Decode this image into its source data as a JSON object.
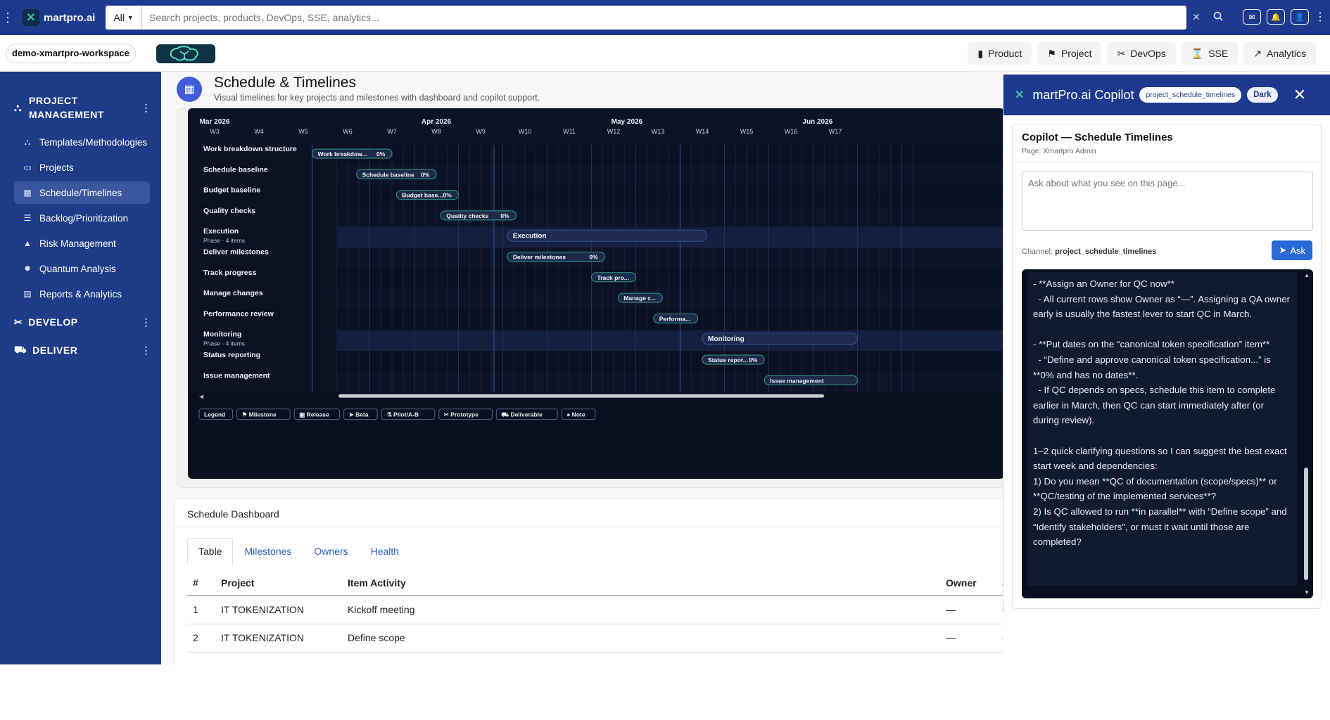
{
  "topbar": {
    "brand": "martpro.ai",
    "search_scope": "All",
    "search_placeholder": "Search projects, products, DevOps, SSE, analytics..."
  },
  "workspace": {
    "name": "demo-xmartpro-workspace",
    "nav": [
      "Product",
      "Project",
      "DevOps",
      "SSE",
      "Analytics"
    ]
  },
  "sidebar": {
    "section_pm": "PROJECT MANAGEMENT",
    "items": [
      {
        "label": "Templates/Methodologies",
        "icon": "diagram-icon"
      },
      {
        "label": "Projects",
        "icon": "folder-icon"
      },
      {
        "label": "Schedule/Timelines",
        "icon": "calendar-icon"
      },
      {
        "label": "Backlog/Prioritization",
        "icon": "list-icon"
      },
      {
        "label": "Risk Management",
        "icon": "warning-icon"
      },
      {
        "label": "Quantum Analysis",
        "icon": "gear-icon"
      },
      {
        "label": "Reports & Analytics",
        "icon": "report-icon"
      }
    ],
    "section_develop": "DEVELOP",
    "section_deliver": "DELIVER"
  },
  "page": {
    "title": "Schedule & Timelines",
    "subtitle": "Visual timelines for key projects and milestones with dashboard and copilot support."
  },
  "gantt": {
    "months": [
      {
        "label": "Mar 2026",
        "week": 3
      },
      {
        "label": "Apr 2026",
        "week": 8
      },
      {
        "label": "May 2026",
        "week": 12.3
      },
      {
        "label": "Jun 2026",
        "week": 16.6
      }
    ],
    "weeks": [
      "W3",
      "W4",
      "W5",
      "W6",
      "W7",
      "W8",
      "W9",
      "W10",
      "W11",
      "W12",
      "W13",
      "W14",
      "W15",
      "W16",
      "W17"
    ],
    "rows": [
      {
        "name": "Work breakdown structure",
        "sub": "",
        "bar": "Work breakdow...",
        "pct": "0%",
        "start": 5.2,
        "end": 7.0,
        "phase": false
      },
      {
        "name": "Schedule baseline",
        "sub": "",
        "bar": "Schedule baseline",
        "pct": "0%",
        "start": 6.2,
        "end": 8.0,
        "phase": false
      },
      {
        "name": "Budget baseline",
        "sub": "",
        "bar": "Budget base...",
        "pct": "0%",
        "start": 7.1,
        "end": 8.5,
        "phase": false
      },
      {
        "name": "Quality checks",
        "sub": "",
        "bar": "Quality checks",
        "pct": "0%",
        "start": 8.1,
        "end": 9.8,
        "phase": false
      },
      {
        "name": "Execution",
        "sub": "Phase · 4 items",
        "bar": "Execution",
        "pct": "",
        "start": 9.6,
        "end": 14.1,
        "phase": true
      },
      {
        "name": "Deliver milestones",
        "sub": "",
        "bar": "Deliver milestones",
        "pct": "0%",
        "start": 9.6,
        "end": 11.8,
        "phase": false
      },
      {
        "name": "Track progress",
        "sub": "",
        "bar": "Track pro...",
        "pct": "",
        "start": 11.5,
        "end": 12.5,
        "phase": false
      },
      {
        "name": "Manage changes",
        "sub": "",
        "bar": "Manage c...",
        "pct": "",
        "start": 12.1,
        "end": 13.1,
        "phase": false
      },
      {
        "name": "Performance review",
        "sub": "",
        "bar": "Performa...",
        "pct": "",
        "start": 12.9,
        "end": 13.9,
        "phase": false
      },
      {
        "name": "Monitoring",
        "sub": "Phase · 4 items",
        "bar": "Monitoring",
        "pct": "",
        "start": 14.0,
        "end": 17.5,
        "phase": true
      },
      {
        "name": "Status reporting",
        "sub": "",
        "bar": "Status repor...",
        "pct": "0%",
        "start": 14.0,
        "end": 15.4,
        "phase": false
      },
      {
        "name": "Issue management",
        "sub": "",
        "bar": "Issue management",
        "pct": "",
        "start": 15.4,
        "end": 17.5,
        "phase": false
      }
    ],
    "legend": [
      {
        "label": "Legend",
        "icon": ""
      },
      {
        "label": "Milestone",
        "icon": "flag-icon"
      },
      {
        "label": "Release",
        "icon": "box-icon"
      },
      {
        "label": "Beta",
        "icon": "send-icon"
      },
      {
        "label": "Pilot/A-B",
        "icon": "flask-icon"
      },
      {
        "label": "Prototype",
        "icon": "tools-icon"
      },
      {
        "label": "Deliverable",
        "icon": "truck-icon"
      },
      {
        "label": "Note",
        "icon": "comment-icon"
      }
    ]
  },
  "dashboard": {
    "title": "Schedule Dashboard",
    "tabs": [
      "Table",
      "Milestones",
      "Owners",
      "Health"
    ],
    "columns": [
      "#",
      "Project",
      "Item Activity",
      "Owner",
      "S"
    ],
    "rows": [
      [
        "1",
        "IT TOKENIZATION",
        "Kickoff meeting",
        "—",
        "C"
      ],
      [
        "2",
        "IT TOKENIZATION",
        "Define scope",
        "—",
        "C"
      ]
    ]
  },
  "copilot": {
    "title": "martPro.ai Copilot",
    "channel_pill": "project_schedule_timelines",
    "theme_pill": "Dark",
    "heading": "Copilot — Schedule Timelines",
    "page_label": "Page: Xmartpro Admin",
    "input_placeholder": "Ask about what you see on this page...",
    "channel_label": "Channel:",
    "channel_value": "project_schedule_timelines",
    "ask_label": "Ask",
    "response": "- **Assign an Owner for QC now**\n  - All current rows show Owner as “—”. Assigning a QA owner early is usually the fastest lever to start QC in March.\n\n- **Put dates on the “canonical token specification” item**\n  - “Define and approve canonical token specification...” is **0% and has no dates**.\n  - If QC depends on specs, schedule this item to complete earlier in March, then QC can start immediately after (or during review).\n\n1–2 quick clarifying questions so I can suggest the best exact start week and dependencies:\n1) Do you mean **QC of documentation (scope/specs)** or **QC/testing of the implemented services**?\n2) Is QC allowed to run **in parallel** with “Define scope” and “Identify stakeholders”, or must it wait until those are completed?"
  }
}
